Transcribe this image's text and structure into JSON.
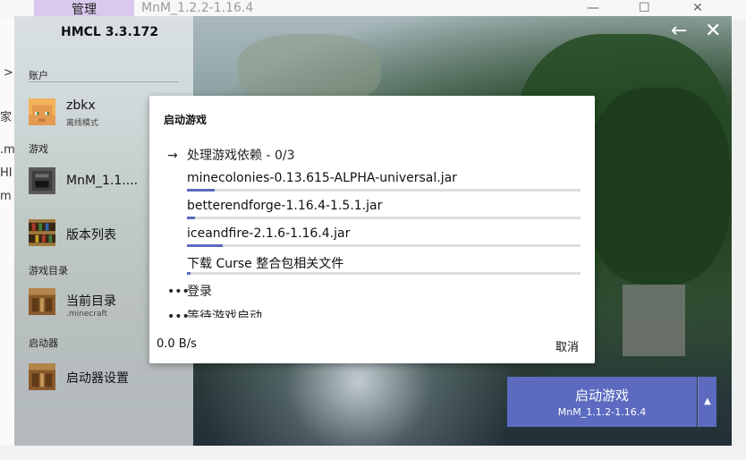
{
  "background_window": {
    "tab_label": "管理",
    "title": "MnM_1.2.2-1.16.4",
    "left_fragments": [
      ">",
      "家",
      ".m",
      "HI",
      "m"
    ]
  },
  "app": {
    "title": "HMCL 3.3.172",
    "close_glyph": "✕",
    "back_glyph": "←"
  },
  "sidebar": {
    "account_section": "账户",
    "account": {
      "name": "zbkx",
      "mode": "离线模式"
    },
    "game_section": "游戏",
    "game_instance": "MnM_1.1....",
    "version_list": "版本列表",
    "game_dir_section": "游戏目录",
    "current_dir": {
      "label": "当前目录",
      "sub": ".minecraft"
    },
    "launcher_section": "启动器",
    "launcher_settings": "启动器设置"
  },
  "dialog": {
    "title": "启动游戏",
    "current_task": "处理游戏依赖 - 0/3",
    "downloads": [
      {
        "name": "minecolonies-0.13.615-ALPHA-universal.jar",
        "progress": 0.07
      },
      {
        "name": "betterendforge-1.16.4-1.5.1.jar",
        "progress": 0.02
      },
      {
        "name": "iceandfire-2.1.6-1.16.4.jar",
        "progress": 0.09
      },
      {
        "name": "下载 Curse 整合包相关文件",
        "progress": 0.01
      }
    ],
    "pending_tasks": [
      "登录",
      "等待游戏启动"
    ],
    "speed": "0.0 B/s",
    "cancel_label": "取消"
  },
  "launch_button": {
    "label": "启动游戏",
    "version": "MnM_1.1.2-1.16.4"
  },
  "colors": {
    "accent": "#5c6bc0",
    "progress_track": "#dcdcdc"
  }
}
